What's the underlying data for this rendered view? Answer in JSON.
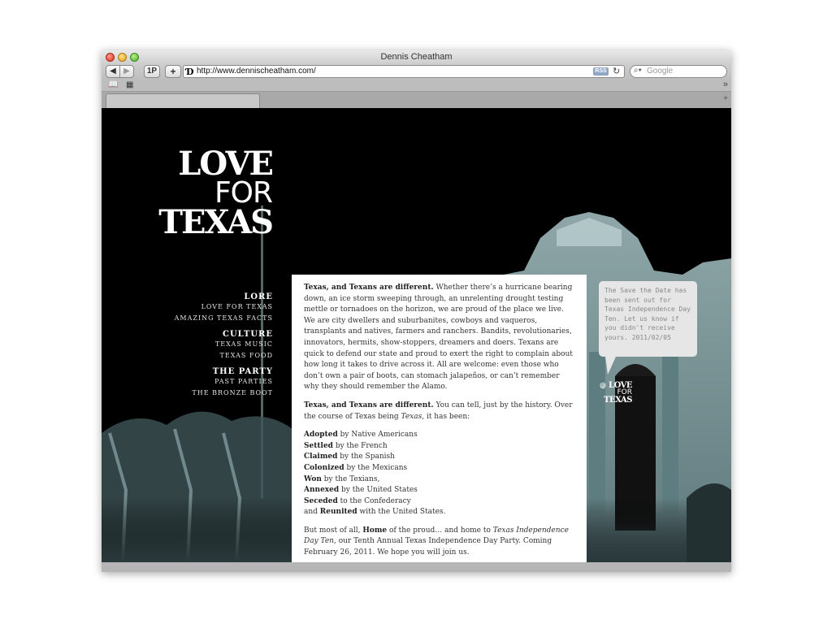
{
  "window": {
    "title": "Dennis Cheatham"
  },
  "toolbar": {
    "back_icon": "◀",
    "forward_icon": "▶",
    "onepassword_label": "1P",
    "add_label": "+",
    "url": "http://www.dennischeatham.com/",
    "rss_label": "RSS",
    "search_placeholder": "Google"
  },
  "site": {
    "logo": {
      "line1": "LOVE",
      "line2": "FOR",
      "line3": "TEXAS"
    },
    "nav": [
      {
        "heading": "LORE",
        "links": [
          "LOVE FOR TEXAS",
          "AMAZING TEXAS FACTS"
        ]
      },
      {
        "heading": "CULTURE",
        "links": [
          "TEXAS MUSIC",
          "TEXAS FOOD"
        ]
      },
      {
        "heading": "THE PARTY",
        "links": [
          "PAST PARTIES",
          "THE BRONZE BOOT"
        ]
      }
    ],
    "article": {
      "p1_bold": "Texas, and Texans are different.",
      "p1_rest": " Whether there’s a hurricane bearing down, an ice storm sweeping through, an unrelenting drought testing mettle or tornadoes on the horizon, we are proud of the place we live. We are city dwellers and suburbanites, cowboys and vaqueros, transplants and natives, farmers and ranchers. Bandits, revolutionaries, innovators, hermits, show-stoppers, dreamers and doers. Texans are quick to defend our state and proud to exert the right to complain about how long it takes to drive across it. All are welcome: even those who don’t own a pair of boots, can stomach jalapeños, or can’t remember why they should remember the Alamo.",
      "p2_bold": "Texas, and Texans are different.",
      "p2_rest": " You can tell, just by the history. Over the course of Texas being ",
      "p2_em": "Texas,",
      "p2_end": " it has been:",
      "history": [
        {
          "verb": "Adopted",
          "rest": " by Native Americans"
        },
        {
          "verb": "Settled",
          "rest": " by the French"
        },
        {
          "verb": "Claimed",
          "rest": " by the Spanish"
        },
        {
          "verb": "Colonized",
          "rest": " by the Mexicans"
        },
        {
          "verb": "Won",
          "rest": " by the Texians,"
        },
        {
          "verb": "Annexed",
          "rest": " by the United States"
        },
        {
          "verb": "Seceded",
          "rest": " to the Confederacy"
        }
      ],
      "last_pre": "and ",
      "last_verb": "Reunited",
      "last_rest": " with the United States.",
      "p4_a": "But most of all, ",
      "p4_bold": "Home",
      "p4_b": " of the proud… and home to ",
      "p4_em": "Texas Independence Day Ten,",
      "p4_c": " our Tenth Annual Texas Independence Day Party. Coming February 26, 2011. We hope you will join us."
    },
    "tweet": "The Save the Date has been sent out for Texas Independence Day Ten. Let us know if you didn't receive yours. 2011/02/05",
    "mini_logo": {
      "at": "@",
      "line1": "LOVE",
      "line2": "FOR",
      "line3": "TEXAS"
    }
  },
  "colors": {
    "page_background": "#000000",
    "article_background": "#ffffff",
    "tweet_background": "#e6e6e6",
    "photo_tint": "#8fb4b8"
  }
}
